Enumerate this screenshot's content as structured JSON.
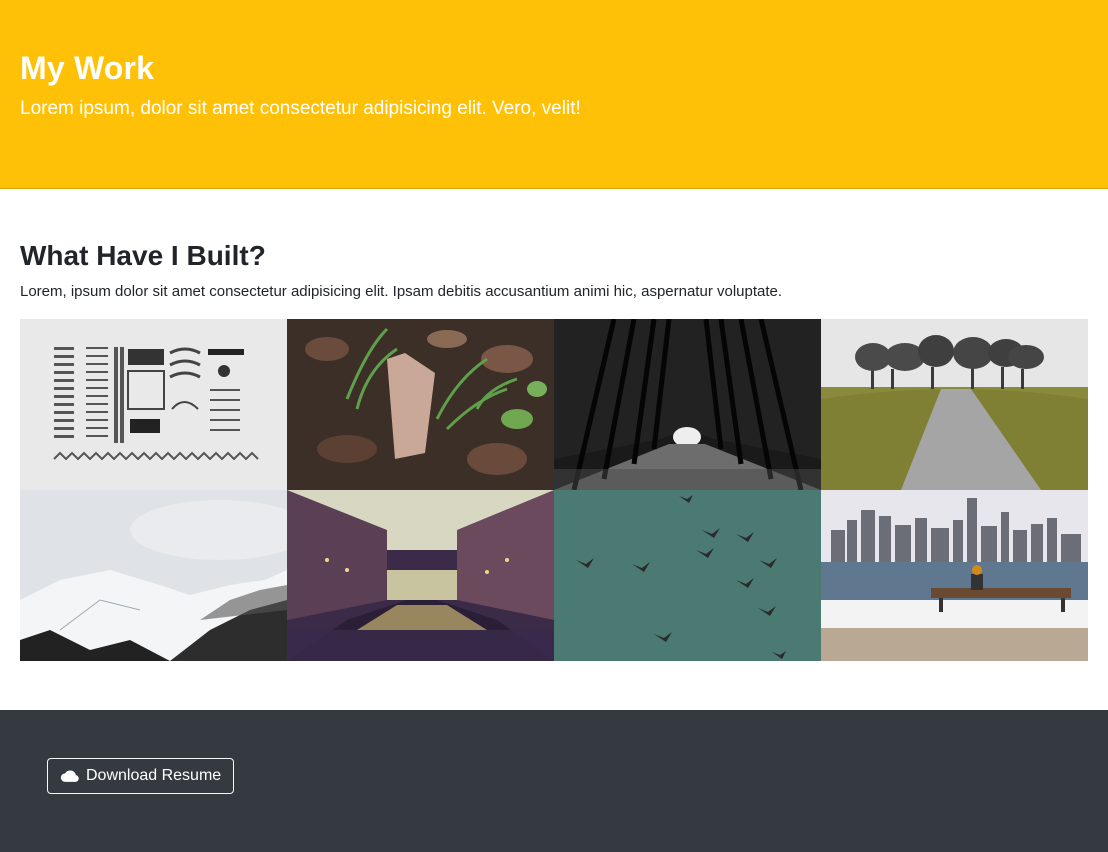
{
  "hero": {
    "title": "My Work",
    "subtitle": "Lorem ipsum, dolor sit amet consectetur adipisicing elit. Vero, velit!",
    "background": "#ffc107"
  },
  "work": {
    "title": "What Have I Built?",
    "description": "Lorem, ipsum dolor sit amet consectetur adipisicing elit. Ipsam debitis accusantium animi hic, aspernatur voluptate."
  },
  "gallery": {
    "images": [
      {
        "subject": "typewriter-parts"
      },
      {
        "subject": "leaves-and-grass"
      },
      {
        "subject": "tree-tunnel-road"
      },
      {
        "subject": "path-to-trees"
      },
      {
        "subject": "snowy-mountains"
      },
      {
        "subject": "canal-city"
      },
      {
        "subject": "birds-in-sky"
      },
      {
        "subject": "city-skyline-bench"
      }
    ]
  },
  "footer": {
    "download_label": "Download Resume",
    "icon": "cloud-icon",
    "background": "#343a40"
  }
}
